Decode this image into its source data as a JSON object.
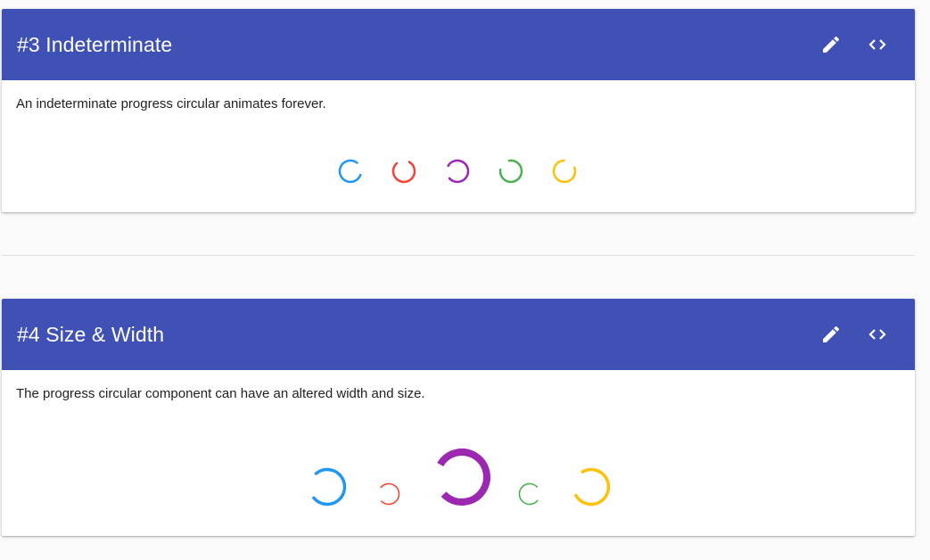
{
  "colors": {
    "header": "#3f51b5",
    "blue": "#2196f3",
    "red": "#f44336",
    "purple": "#9c27b0",
    "green": "#4caf50",
    "amber": "#ffc107"
  },
  "cards": [
    {
      "title": "#3 Indeterminate",
      "description": "An indeterminate progress circular animates forever.",
      "icons": [
        "edit-icon",
        "code-icon"
      ],
      "spinners": [
        "blue",
        "red",
        "purple",
        "green",
        "amber"
      ]
    },
    {
      "title": "#4 Size & Width",
      "description": "The progress circular component can have an altered width and size.",
      "icons": [
        "edit-icon",
        "code-icon"
      ],
      "spinners": [
        "blue",
        "red",
        "purple",
        "green",
        "amber"
      ]
    }
  ]
}
